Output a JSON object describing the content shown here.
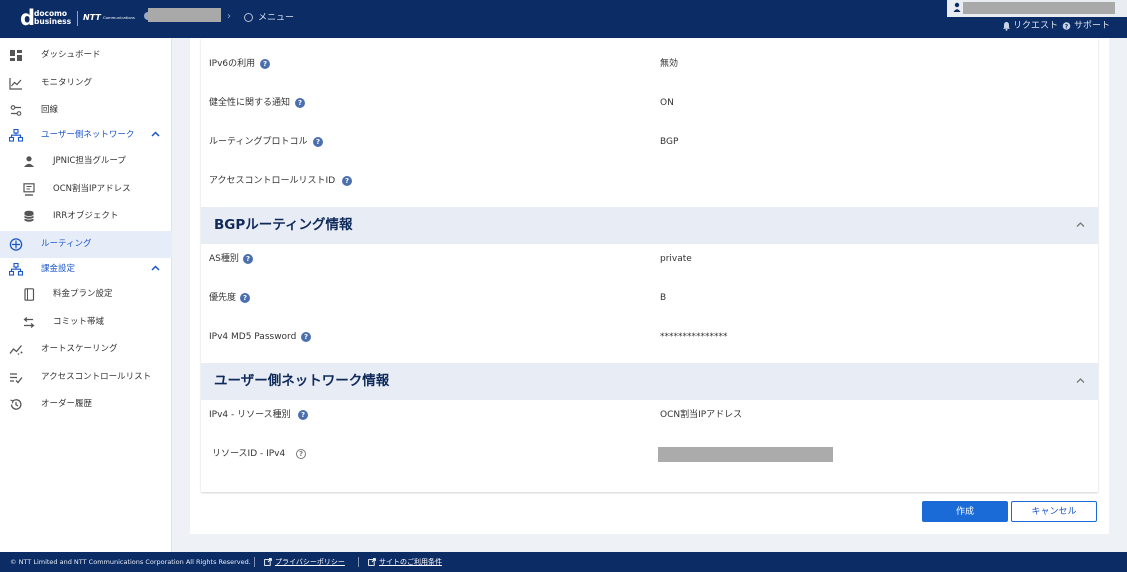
{
  "header": {
    "logo_line1": "docomo",
    "logo_line2": "business",
    "logo_letter": "d",
    "partner_logo": "NTT",
    "partner_logo_sub": "Communications",
    "breadcrumb_current": "メニュー",
    "request_label": "リクエスト",
    "support_label": "サポート"
  },
  "sidebar": {
    "items": [
      {
        "label": "ダッシュボード",
        "icon": "dashboard-icon"
      },
      {
        "label": "モニタリング",
        "icon": "chart-line-icon"
      },
      {
        "label": "回線",
        "icon": "lines-icon"
      },
      {
        "label": "ユーザー側ネットワーク",
        "icon": "network-icon"
      },
      {
        "label": "JPNIC担当グループ",
        "icon": "person-icon"
      },
      {
        "label": "OCN割当IPアドレス",
        "icon": "address-icon"
      },
      {
        "label": "IRRオブジェクト",
        "icon": "database-icon"
      },
      {
        "label": "ルーティング",
        "icon": "routing-icon"
      },
      {
        "label": "課金設定",
        "icon": "billing-network-icon"
      },
      {
        "label": "料金プラン設定",
        "icon": "plan-icon"
      },
      {
        "label": "コミット帯域",
        "icon": "bandwidth-icon"
      },
      {
        "label": "オートスケーリング",
        "icon": "autoscaling-icon"
      },
      {
        "label": "アクセスコントロールリスト",
        "icon": "acl-icon"
      },
      {
        "label": "オーダー履歴",
        "icon": "history-icon"
      }
    ]
  },
  "routing": {
    "rows": [
      {
        "label": "IPv6の利用",
        "value": "無効"
      },
      {
        "label": "健全性に関する通知",
        "value": "ON"
      },
      {
        "label": "ルーティングプロトコル",
        "value": "BGP"
      },
      {
        "label": "アクセスコントロールリストID",
        "value": ""
      }
    ]
  },
  "bgp": {
    "title": "BGPルーティング情報",
    "rows": [
      {
        "label": "AS種別",
        "value": "private"
      },
      {
        "label": "優先度",
        "value": "B"
      },
      {
        "label": "IPv4 MD5 Password",
        "value": "***************"
      }
    ]
  },
  "user_network": {
    "title": "ユーザー側ネットワーク情報",
    "rows": [
      {
        "label": "IPv4 - リソース種別",
        "value": "OCN割当IPアドレス"
      },
      {
        "label": "リソースID - IPv4",
        "value": ""
      }
    ]
  },
  "actions": {
    "create_label": "作成",
    "cancel_label": "キャンセル"
  },
  "footer": {
    "copyright": "© NTT Limited and NTT Communications Corporation All Rights Reserved.",
    "privacy_label": "プライバシーポリシー",
    "terms_label": "サイトのご利用条件"
  },
  "colors": {
    "header_bg": "#0c2c66",
    "accent": "#1a6bd8",
    "section_bg": "#e8ecf4",
    "help_icon": "#4b6fae"
  }
}
